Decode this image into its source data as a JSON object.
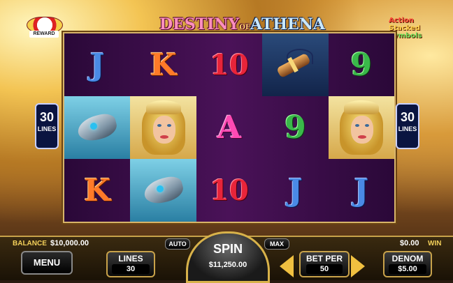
{
  "logos": {
    "left_badge": "REWARD",
    "title_part1": "DESTINY",
    "title_of": "OF",
    "title_part2": "ATHENA",
    "right_line1": "Action",
    "right_line2": "Stacked",
    "right_line3": "Symbols"
  },
  "reels": [
    [
      "J",
      "K",
      "10",
      "horn",
      "9"
    ],
    [
      "helmet",
      "athena",
      "A",
      "9",
      "athena"
    ],
    [
      "K",
      "helmet",
      "10",
      "J",
      "J"
    ]
  ],
  "lines_badge": {
    "number": "30",
    "label": "LINES"
  },
  "balance": {
    "label": "BALANCE",
    "value": "$10,000.00"
  },
  "win": {
    "value": "$0.00",
    "label": "WIN"
  },
  "buttons": {
    "menu": "MENU",
    "lines_label": "LINES",
    "lines_value": "30",
    "auto": "AUTO",
    "spin": "SPIN",
    "spin_value": "$11,250.00",
    "max": "MAX",
    "bet_per_label": "BET PER",
    "bet_per_value": "50",
    "denom_label": "DENOM",
    "denom_value": "$5.00"
  },
  "colors": {
    "gold": "#c8a24a",
    "reel_bg": "#4a1258"
  }
}
